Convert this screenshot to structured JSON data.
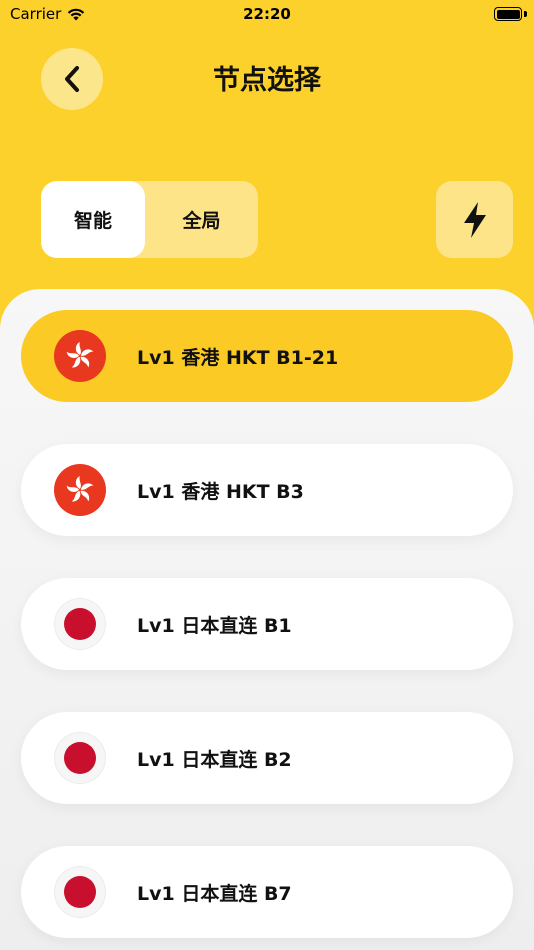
{
  "status_bar": {
    "carrier": "Carrier",
    "time": "22:20"
  },
  "header": {
    "title": "节点选择"
  },
  "mode_tabs": [
    {
      "label": "智能",
      "active": true
    },
    {
      "label": "全局",
      "active": false
    }
  ],
  "colors": {
    "accent": "#fcd12b",
    "selected_card": "#fbca25",
    "hk_red": "#e8381f",
    "jp_red": "#c8102e"
  },
  "icons": {
    "back": "chevron-left-icon",
    "speed_test": "lightning-bolt-icon",
    "hk_flag": "hong-kong-flag-icon",
    "jp_flag": "japan-flag-icon"
  },
  "nodes": [
    {
      "label": "Lv1 香港 HKT B1-21",
      "flag": "hk",
      "selected": true
    },
    {
      "label": "Lv1 香港 HKT B3",
      "flag": "hk",
      "selected": false
    },
    {
      "label": "Lv1 日本直连 B1",
      "flag": "jp",
      "selected": false
    },
    {
      "label": "Lv1 日本直连 B2",
      "flag": "jp",
      "selected": false
    },
    {
      "label": "Lv1 日本直连 B7",
      "flag": "jp",
      "selected": false
    }
  ]
}
